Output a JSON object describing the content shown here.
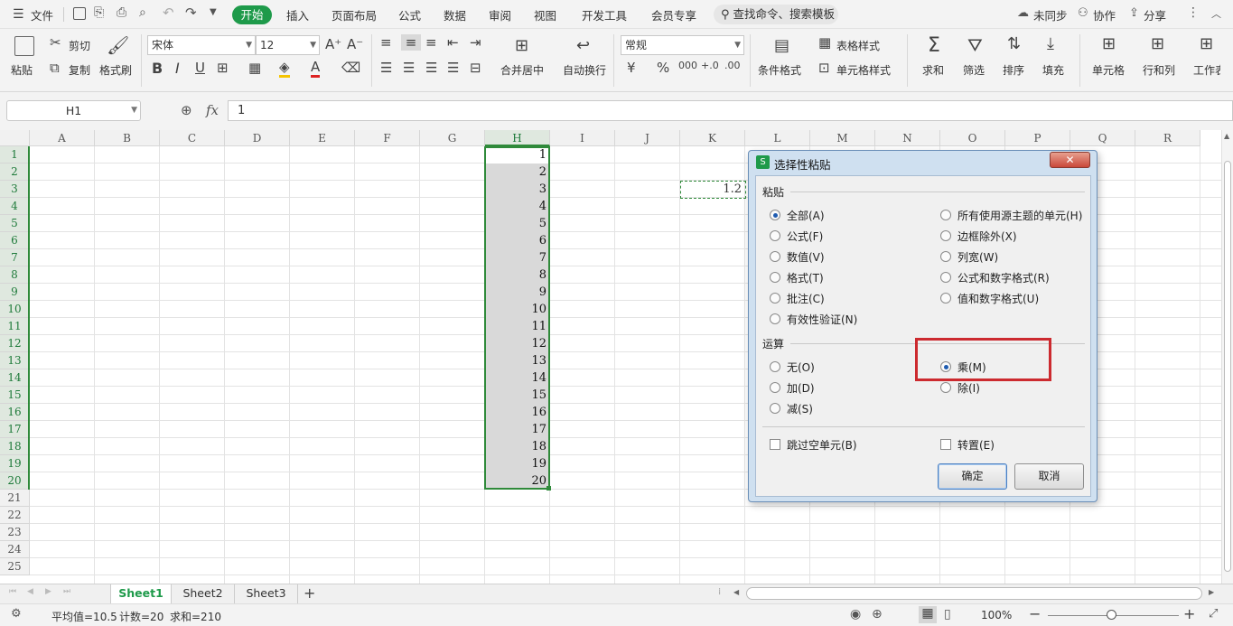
{
  "menubar": {
    "file_label": "文件",
    "tabs": [
      "开始",
      "插入",
      "页面布局",
      "公式",
      "数据",
      "审阅",
      "视图",
      "开发工具",
      "会员专享"
    ],
    "search_label": "查找命令、搜索模板",
    "sync_label": "未同步",
    "collab_label": "协作",
    "share_label": "分享"
  },
  "ribbon": {
    "paste": "粘贴",
    "cut": "剪切",
    "copy": "复制",
    "format_painter": "格式刷",
    "font_name": "宋体",
    "font_size": "12",
    "number_format": "常规",
    "merge_center": "合并居中",
    "auto_wrap": "自动换行",
    "cond_format": "条件格式",
    "table_style": "表格样式",
    "cell_style": "单元格样式",
    "sum": "求和",
    "filter": "筛选",
    "sort": "排序",
    "fill": "填充",
    "cells": "单元格",
    "row_col": "行和列",
    "worksheet": "工作表",
    "currency_symbol": "¥",
    "percent_symbol": "%",
    "thousands_symbol": "000",
    "inc_decimal": "+.0",
    "dec_decimal": ".00"
  },
  "formula_bar": {
    "name_box": "H1",
    "fx": "fx",
    "value": "1"
  },
  "grid": {
    "columns": [
      "A",
      "B",
      "C",
      "D",
      "E",
      "F",
      "G",
      "H",
      "I",
      "J",
      "K",
      "L",
      "M",
      "N",
      "O",
      "P",
      "Q",
      "R"
    ],
    "rows": [
      "1",
      "2",
      "3",
      "4",
      "5",
      "6",
      "7",
      "8",
      "9",
      "10",
      "11",
      "12",
      "13",
      "14",
      "15",
      "16",
      "17",
      "18",
      "19",
      "20",
      "21",
      "22",
      "23",
      "24",
      "25"
    ],
    "h_values": [
      "1",
      "2",
      "3",
      "4",
      "5",
      "6",
      "7",
      "8",
      "9",
      "10",
      "11",
      "12",
      "13",
      "14",
      "15",
      "16",
      "17",
      "18",
      "19",
      "20"
    ],
    "k3_value": "1.2"
  },
  "dialog": {
    "title": "选择性粘贴",
    "paste_group": "粘贴",
    "paste_left": [
      "全部(A)",
      "公式(F)",
      "数值(V)",
      "格式(T)",
      "批注(C)",
      "有效性验证(N)"
    ],
    "paste_right": [
      "所有使用源主题的单元(H)",
      "边框除外(X)",
      "列宽(W)",
      "公式和数字格式(R)",
      "值和数字格式(U)"
    ],
    "op_group": "运算",
    "op_left": [
      "无(O)",
      "加(D)",
      "减(S)"
    ],
    "op_right": [
      "乘(M)",
      "除(I)"
    ],
    "skip_blanks": "跳过空单元(B)",
    "transpose": "转置(E)",
    "ok": "确定",
    "cancel": "取消",
    "highlight_color": "#cc2a2f"
  },
  "sheets": {
    "tabs": [
      "Sheet1",
      "Sheet2",
      "Sheet3"
    ],
    "add": "+"
  },
  "status": {
    "average": "平均值=10.5",
    "count": "计数=20",
    "sum": "求和=210",
    "zoom": "100%"
  },
  "colors": {
    "accent": "#1e9a4a"
  }
}
